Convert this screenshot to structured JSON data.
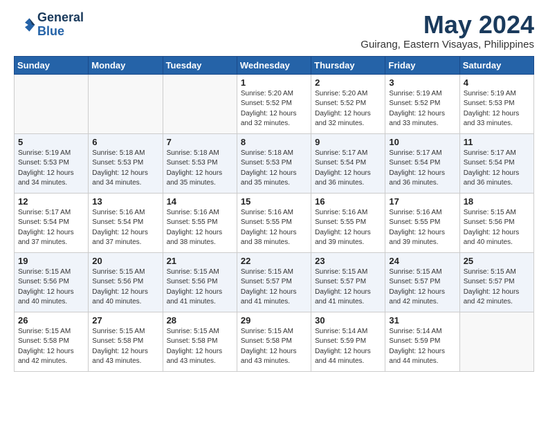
{
  "header": {
    "logo_line1": "General",
    "logo_line2": "Blue",
    "month": "May 2024",
    "location": "Guirang, Eastern Visayas, Philippines"
  },
  "weekdays": [
    "Sunday",
    "Monday",
    "Tuesday",
    "Wednesday",
    "Thursday",
    "Friday",
    "Saturday"
  ],
  "weeks": [
    [
      {
        "day": "",
        "info": ""
      },
      {
        "day": "",
        "info": ""
      },
      {
        "day": "",
        "info": ""
      },
      {
        "day": "1",
        "info": "Sunrise: 5:20 AM\nSunset: 5:52 PM\nDaylight: 12 hours\nand 32 minutes."
      },
      {
        "day": "2",
        "info": "Sunrise: 5:20 AM\nSunset: 5:52 PM\nDaylight: 12 hours\nand 32 minutes."
      },
      {
        "day": "3",
        "info": "Sunrise: 5:19 AM\nSunset: 5:52 PM\nDaylight: 12 hours\nand 33 minutes."
      },
      {
        "day": "4",
        "info": "Sunrise: 5:19 AM\nSunset: 5:53 PM\nDaylight: 12 hours\nand 33 minutes."
      }
    ],
    [
      {
        "day": "5",
        "info": "Sunrise: 5:19 AM\nSunset: 5:53 PM\nDaylight: 12 hours\nand 34 minutes."
      },
      {
        "day": "6",
        "info": "Sunrise: 5:18 AM\nSunset: 5:53 PM\nDaylight: 12 hours\nand 34 minutes."
      },
      {
        "day": "7",
        "info": "Sunrise: 5:18 AM\nSunset: 5:53 PM\nDaylight: 12 hours\nand 35 minutes."
      },
      {
        "day": "8",
        "info": "Sunrise: 5:18 AM\nSunset: 5:53 PM\nDaylight: 12 hours\nand 35 minutes."
      },
      {
        "day": "9",
        "info": "Sunrise: 5:17 AM\nSunset: 5:54 PM\nDaylight: 12 hours\nand 36 minutes."
      },
      {
        "day": "10",
        "info": "Sunrise: 5:17 AM\nSunset: 5:54 PM\nDaylight: 12 hours\nand 36 minutes."
      },
      {
        "day": "11",
        "info": "Sunrise: 5:17 AM\nSunset: 5:54 PM\nDaylight: 12 hours\nand 36 minutes."
      }
    ],
    [
      {
        "day": "12",
        "info": "Sunrise: 5:17 AM\nSunset: 5:54 PM\nDaylight: 12 hours\nand 37 minutes."
      },
      {
        "day": "13",
        "info": "Sunrise: 5:16 AM\nSunset: 5:54 PM\nDaylight: 12 hours\nand 37 minutes."
      },
      {
        "day": "14",
        "info": "Sunrise: 5:16 AM\nSunset: 5:55 PM\nDaylight: 12 hours\nand 38 minutes."
      },
      {
        "day": "15",
        "info": "Sunrise: 5:16 AM\nSunset: 5:55 PM\nDaylight: 12 hours\nand 38 minutes."
      },
      {
        "day": "16",
        "info": "Sunrise: 5:16 AM\nSunset: 5:55 PM\nDaylight: 12 hours\nand 39 minutes."
      },
      {
        "day": "17",
        "info": "Sunrise: 5:16 AM\nSunset: 5:55 PM\nDaylight: 12 hours\nand 39 minutes."
      },
      {
        "day": "18",
        "info": "Sunrise: 5:15 AM\nSunset: 5:56 PM\nDaylight: 12 hours\nand 40 minutes."
      }
    ],
    [
      {
        "day": "19",
        "info": "Sunrise: 5:15 AM\nSunset: 5:56 PM\nDaylight: 12 hours\nand 40 minutes."
      },
      {
        "day": "20",
        "info": "Sunrise: 5:15 AM\nSunset: 5:56 PM\nDaylight: 12 hours\nand 40 minutes."
      },
      {
        "day": "21",
        "info": "Sunrise: 5:15 AM\nSunset: 5:56 PM\nDaylight: 12 hours\nand 41 minutes."
      },
      {
        "day": "22",
        "info": "Sunrise: 5:15 AM\nSunset: 5:57 PM\nDaylight: 12 hours\nand 41 minutes."
      },
      {
        "day": "23",
        "info": "Sunrise: 5:15 AM\nSunset: 5:57 PM\nDaylight: 12 hours\nand 41 minutes."
      },
      {
        "day": "24",
        "info": "Sunrise: 5:15 AM\nSunset: 5:57 PM\nDaylight: 12 hours\nand 42 minutes."
      },
      {
        "day": "25",
        "info": "Sunrise: 5:15 AM\nSunset: 5:57 PM\nDaylight: 12 hours\nand 42 minutes."
      }
    ],
    [
      {
        "day": "26",
        "info": "Sunrise: 5:15 AM\nSunset: 5:58 PM\nDaylight: 12 hours\nand 42 minutes."
      },
      {
        "day": "27",
        "info": "Sunrise: 5:15 AM\nSunset: 5:58 PM\nDaylight: 12 hours\nand 43 minutes."
      },
      {
        "day": "28",
        "info": "Sunrise: 5:15 AM\nSunset: 5:58 PM\nDaylight: 12 hours\nand 43 minutes."
      },
      {
        "day": "29",
        "info": "Sunrise: 5:15 AM\nSunset: 5:58 PM\nDaylight: 12 hours\nand 43 minutes."
      },
      {
        "day": "30",
        "info": "Sunrise: 5:14 AM\nSunset: 5:59 PM\nDaylight: 12 hours\nand 44 minutes."
      },
      {
        "day": "31",
        "info": "Sunrise: 5:14 AM\nSunset: 5:59 PM\nDaylight: 12 hours\nand 44 minutes."
      },
      {
        "day": "",
        "info": ""
      }
    ]
  ]
}
